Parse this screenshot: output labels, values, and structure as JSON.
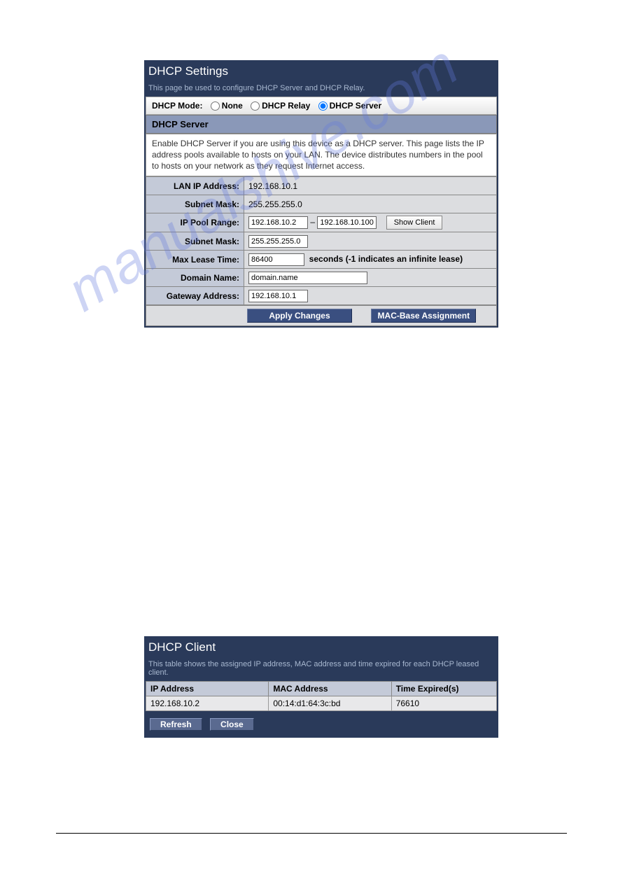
{
  "dhcp_settings": {
    "title": "DHCP Settings",
    "subtitle": "This page be used to configure DHCP Server and DHCP Relay.",
    "mode_label": "DHCP Mode:",
    "modes": {
      "none": "None",
      "relay": "DHCP Relay",
      "server": "DHCP Server"
    },
    "section_head": "DHCP Server",
    "description": "Enable DHCP Server if you are using this device as a DHCP server. This page lists the IP address pools available to hosts on your LAN. The device distributes numbers in the pool to hosts on your network as they request Internet access.",
    "rows": {
      "lan_ip_label": "LAN IP Address:",
      "lan_ip_value": "192.168.10.1",
      "subnet1_label": "Subnet Mask:",
      "subnet1_value": "255.255.255.0",
      "pool_label": "IP Pool Range:",
      "pool_start": "192.168.10.2",
      "pool_dash": "–",
      "pool_end": "192.168.10.100",
      "show_client": "Show Client",
      "subnet2_label": "Subnet Mask:",
      "subnet2_value": "255.255.255.0",
      "lease_label": "Max Lease Time:",
      "lease_value": "86400",
      "lease_note": "seconds (-1 indicates an infinite lease)",
      "domain_label": "Domain Name:",
      "domain_value": "domain.name",
      "gateway_label": "Gateway Address:",
      "gateway_value": "192.168.10.1"
    },
    "buttons": {
      "apply": "Apply Changes",
      "mac": "MAC-Base Assignment"
    }
  },
  "dhcp_client": {
    "title": "DHCP Client",
    "subtitle": "This table shows the assigned IP address, MAC address and time expired for each DHCP leased client.",
    "headers": {
      "ip": "IP Address",
      "mac": "MAC Address",
      "time": "Time Expired(s)"
    },
    "row": {
      "ip": "192.168.10.2",
      "mac": "00:14:d1:64:3c:bd",
      "time": "76610"
    },
    "buttons": {
      "refresh": "Refresh",
      "close": "Close"
    }
  },
  "watermark": "manualshive.com"
}
